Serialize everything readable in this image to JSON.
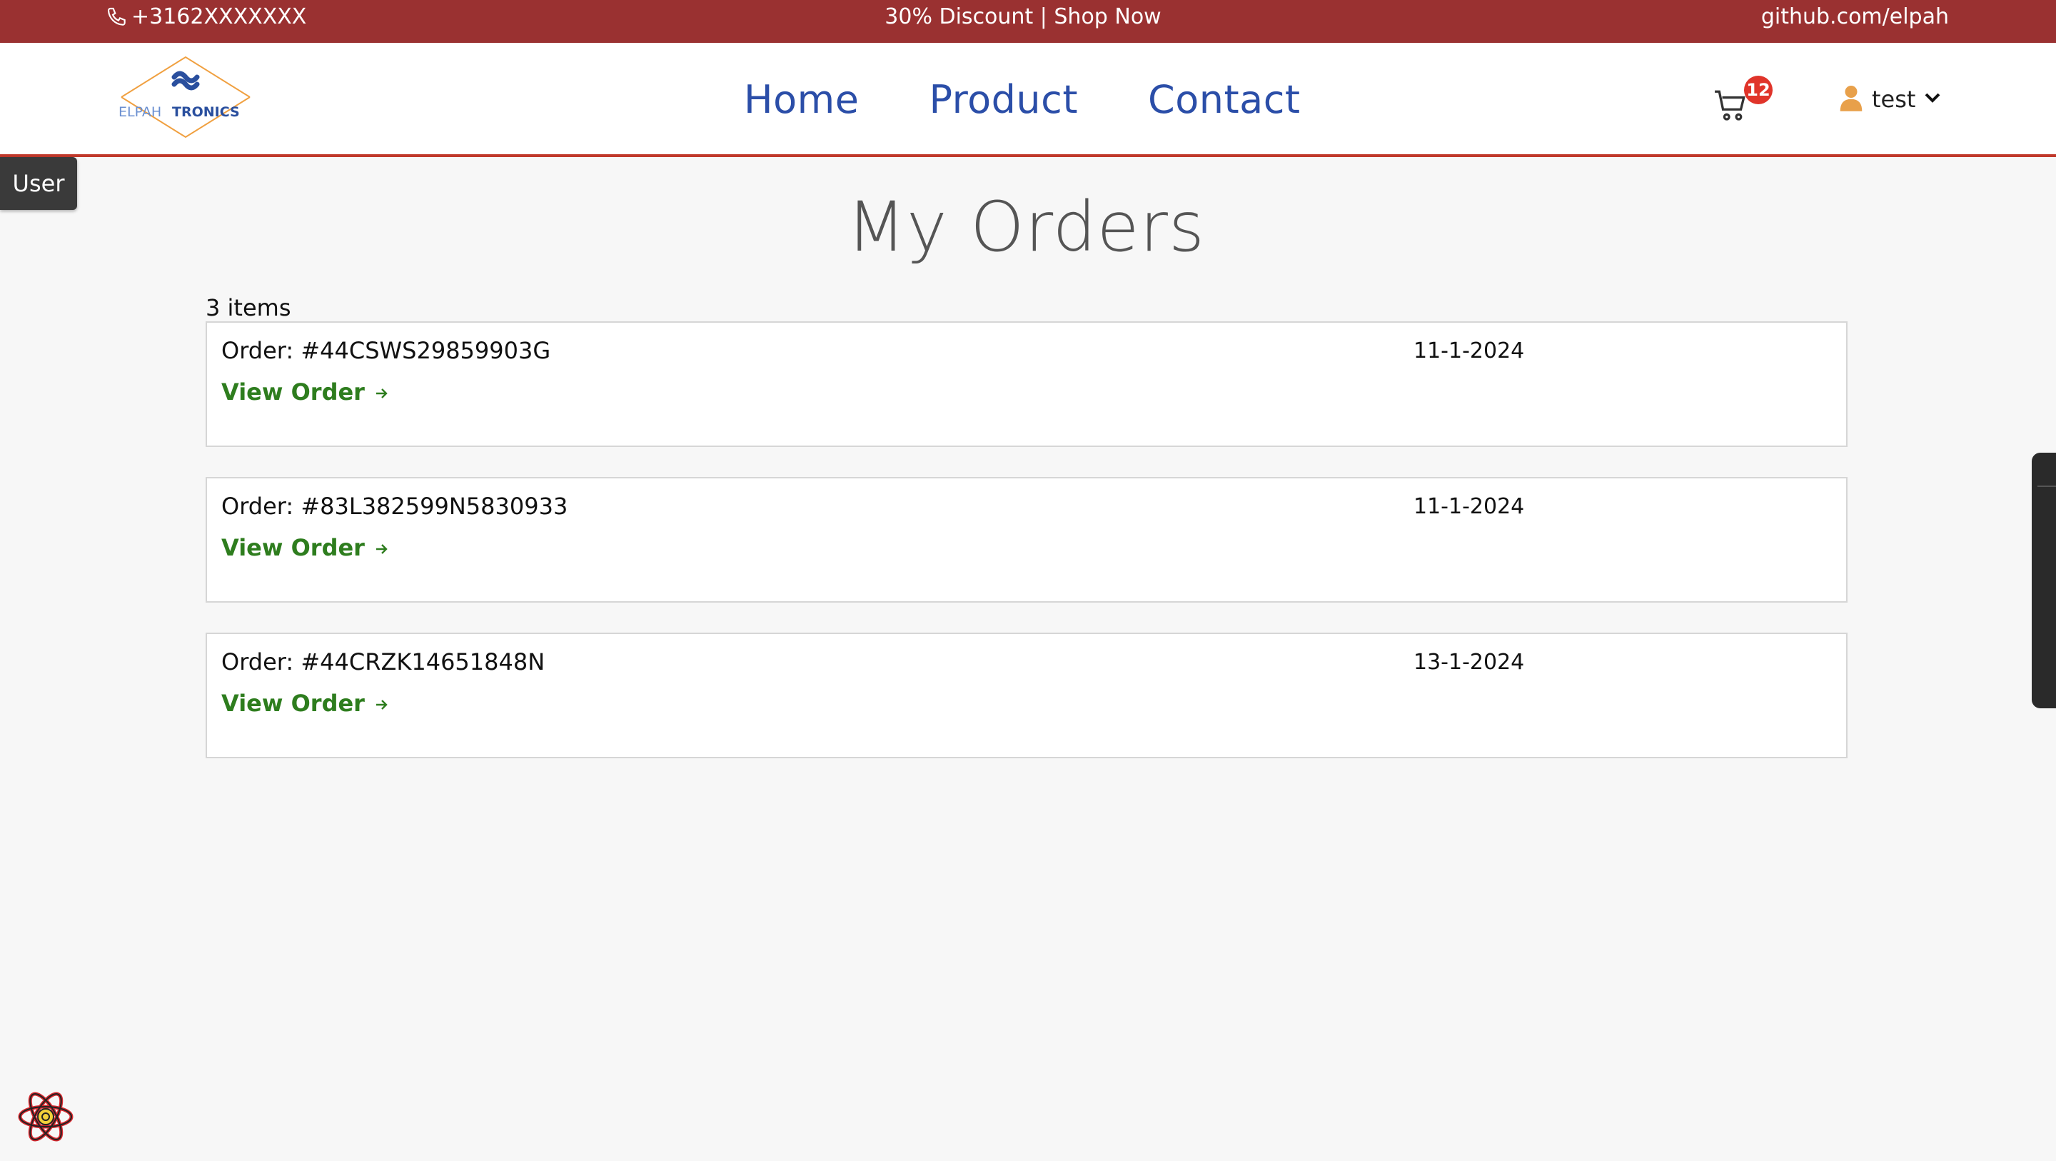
{
  "topbar": {
    "phone": "+3162XXXXXXX",
    "promo_discount": "30% Discount",
    "promo_separator": " | ",
    "promo_shop": "Shop Now",
    "github": "github.com/elpah"
  },
  "logo": {
    "text_left": "ELPAH",
    "text_right": "TRONICS"
  },
  "nav": {
    "home": "Home",
    "product": "Product",
    "contact": "Contact"
  },
  "cart": {
    "count": "12"
  },
  "user": {
    "name": "test"
  },
  "side_tab": {
    "label": "User"
  },
  "page": {
    "title": "My Orders",
    "item_count": "3 items"
  },
  "orders": [
    {
      "id": "Order: #44CSWS29859903G",
      "date": "11-1-2024",
      "link": "View Order"
    },
    {
      "id": "Order: #83L382599N5830933",
      "date": "11-1-2024",
      "link": "View Order"
    },
    {
      "id": "Order: #44CRZK14651848N",
      "date": "13-1-2024",
      "link": "View Order"
    }
  ],
  "colors": {
    "topbar": "#9a3131",
    "nav_link": "#2b4ea8",
    "view_order": "#2e7d1e",
    "header_border": "#c0392b",
    "cart_badge": "#e0342a",
    "user_icon": "#e8a04a"
  }
}
